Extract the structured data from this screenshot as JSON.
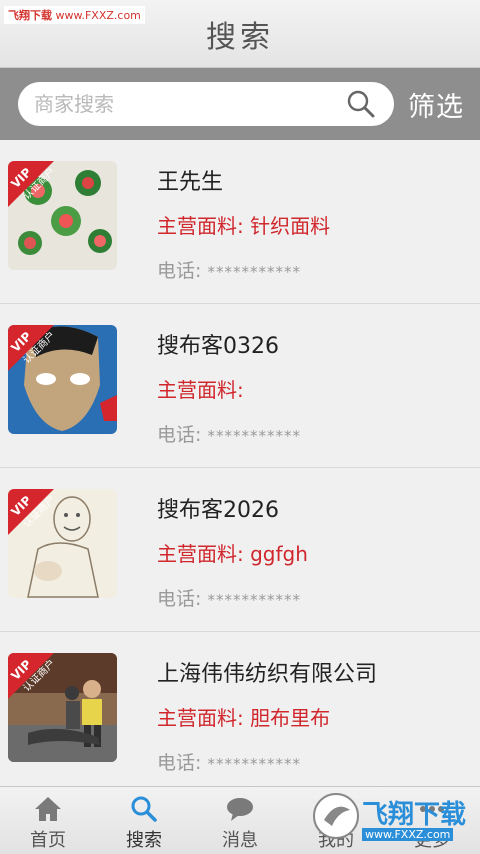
{
  "watermark_top": {
    "part1": "飞翔下载",
    "part2": "www.FXXZ.com"
  },
  "header": {
    "title": "搜索"
  },
  "search": {
    "placeholder": "商家搜索",
    "filter_label": "筛选"
  },
  "vip_badge": {
    "line1": "VIP",
    "line2": "认证商户"
  },
  "merchants": [
    {
      "name": "王先生",
      "material": "主营面料: 针织面料",
      "phone_label": "电话:",
      "phone_value": "***********"
    },
    {
      "name": "搜布客0326",
      "material": "主营面料:",
      "phone_label": "电话:",
      "phone_value": "***********"
    },
    {
      "name": "搜布客2026",
      "material": "主营面料: ggfgh",
      "phone_label": "电话:",
      "phone_value": "***********"
    },
    {
      "name": "上海伟伟纺织有限公司",
      "material": "主营面料: 胆布里布",
      "phone_label": "电话:",
      "phone_value": "***********"
    }
  ],
  "tabbar": {
    "tabs": [
      {
        "label": "首页",
        "icon": "home-icon"
      },
      {
        "label": "搜索",
        "icon": "search-icon"
      },
      {
        "label": "消息",
        "icon": "chat-bubble-icon"
      },
      {
        "label": "我的",
        "icon": "user-icon"
      },
      {
        "label": "更多",
        "icon": "more-icon"
      }
    ],
    "active_index": 1
  },
  "watermark_bottom": {
    "big": "飞翔下载",
    "small": "www.FXXZ.com"
  },
  "colors": {
    "accent_red": "#d0272d",
    "search_bar_bg": "#8e8e8e",
    "active_tab": "#2a8fd8"
  }
}
